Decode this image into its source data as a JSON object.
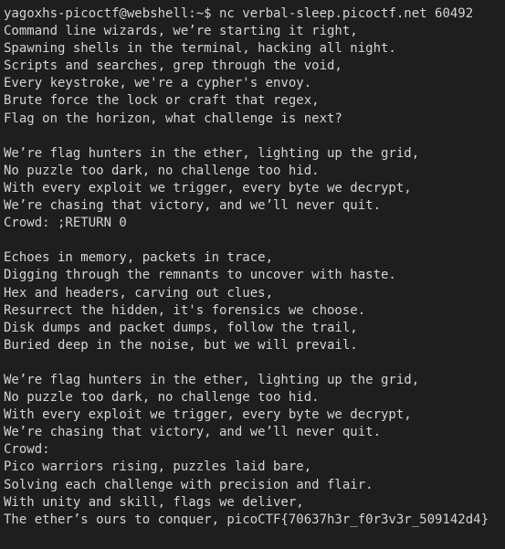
{
  "terminal": {
    "prompt": "yagoxhs-picoctf@webshell:~$",
    "command": " nc verbal-sleep.picoctf.net 60492",
    "lines": [
      "Command line wizards, we’re starting it right,",
      "Spawning shells in the terminal, hacking all night.",
      "Scripts and searches, grep through the void,",
      "Every keystroke, we're a cypher's envoy.",
      "Brute force the lock or craft that regex,",
      "Flag on the horizon, what challenge is next?",
      "",
      "We’re flag hunters in the ether, lighting up the grid,",
      "No puzzle too dark, no challenge too hid.",
      "With every exploit we trigger, every byte we decrypt,",
      "We’re chasing that victory, and we’ll never quit.",
      "Crowd: ;RETURN 0",
      "",
      "Echoes in memory, packets in trace,",
      "Digging through the remnants to uncover with haste.",
      "Hex and headers, carving out clues,",
      "Resurrect the hidden, it's forensics we choose.",
      "Disk dumps and packet dumps, follow the trail,",
      "Buried deep in the noise, but we will prevail.",
      "",
      "We’re flag hunters in the ether, lighting up the grid,",
      "No puzzle too dark, no challenge too hid.",
      "With every exploit we trigger, every byte we decrypt,",
      "We’re chasing that victory, and we’ll never quit.",
      "Crowd:",
      "Pico warriors rising, puzzles laid bare,",
      "Solving each challenge with precision and flair.",
      "With unity and skill, flags we deliver,",
      "The ether’s ours to conquer, picoCTF{70637h3r_f0r3v3r_509142d4}"
    ]
  },
  "colors": {
    "background": "#1e1e1e",
    "text": "#d4d4d4"
  }
}
